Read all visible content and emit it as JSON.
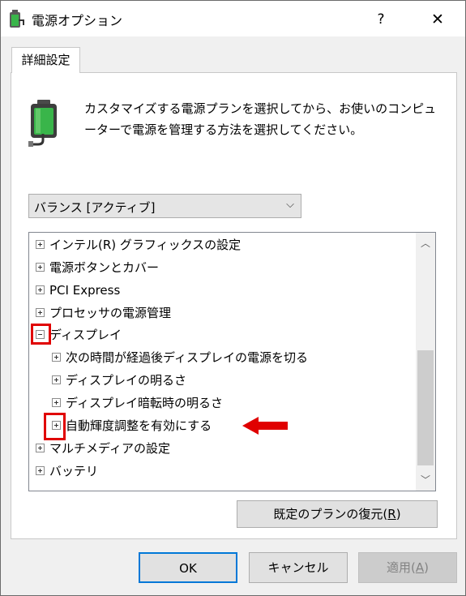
{
  "window": {
    "title": "電源オプション",
    "help_glyph": "?",
    "close_glyph": "✕"
  },
  "tab": {
    "label": "詳細設定"
  },
  "description": "カスタマイズする電源プランを選択してから、お使いのコンピューターで電源を管理する方法を選択してください。",
  "plan_select": {
    "value": "バランス [アクティブ]",
    "arrow": "⌵"
  },
  "tree": {
    "items": [
      {
        "label": "インテル(R) グラフィックスの設定",
        "expanded": false
      },
      {
        "label": "電源ボタンとカバー",
        "expanded": false
      },
      {
        "label": "PCI Express",
        "expanded": false
      },
      {
        "label": "プロセッサの電源管理",
        "expanded": false
      },
      {
        "label": "ディスプレイ",
        "expanded": true
      },
      {
        "label": "次の時間が経過後ディスプレイの電源を切る",
        "expanded": false
      },
      {
        "label": "ディスプレイの明るさ",
        "expanded": false
      },
      {
        "label": "ディスプレイ暗転時の明るさ",
        "expanded": false
      },
      {
        "label": "自動輝度調整を有効にする",
        "expanded": false
      },
      {
        "label": "マルチメディアの設定",
        "expanded": false
      },
      {
        "label": "バッテリ",
        "expanded": false
      }
    ],
    "scroll_up": "︿",
    "scroll_down": "﹀"
  },
  "buttons": {
    "restore_prefix": "既定のプランの復元(",
    "restore_key": "R",
    "restore_suffix": ")",
    "ok": "OK",
    "cancel": "キャンセル",
    "apply_prefix": "適用(",
    "apply_key": "A",
    "apply_suffix": ")"
  },
  "colors": {
    "highlight_red": "#e00000",
    "focus_blue": "#0078d7",
    "battery_green": "#39b54a"
  },
  "icons": [
    "power-options-icon",
    "battery-plug-icon",
    "chevron-down-icon",
    "scroll-up-icon",
    "scroll-down-icon",
    "red-arrow-icon"
  ]
}
